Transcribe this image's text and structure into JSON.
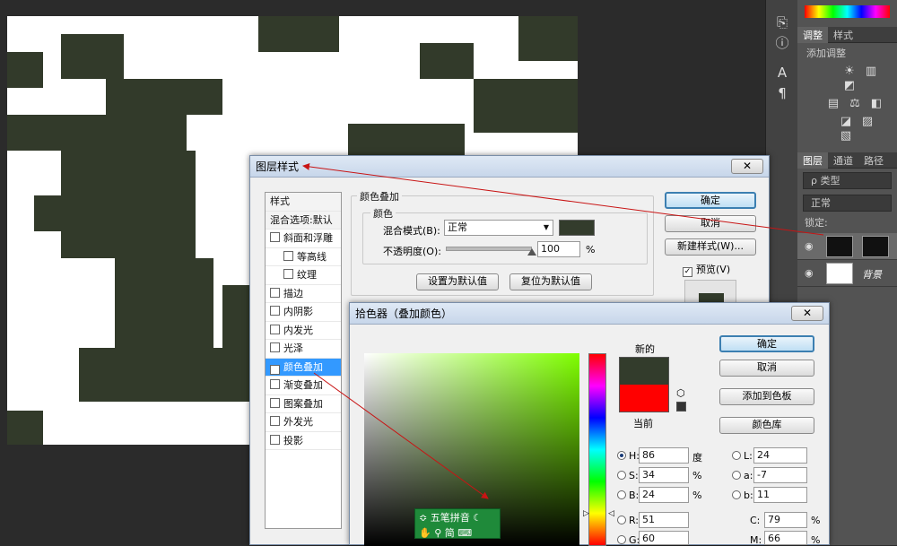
{
  "layer_style": {
    "title": "图层样式",
    "close": "✕",
    "styles_header": "样式",
    "blend_options": "混合选项:默认",
    "items": [
      {
        "label": "斜面和浮雕",
        "checked": false,
        "sub": false
      },
      {
        "label": "等高线",
        "checked": false,
        "sub": true
      },
      {
        "label": "纹理",
        "checked": false,
        "sub": true
      },
      {
        "label": "描边",
        "checked": false,
        "sub": false
      },
      {
        "label": "内阴影",
        "checked": false,
        "sub": false
      },
      {
        "label": "内发光",
        "checked": false,
        "sub": false
      },
      {
        "label": "光泽",
        "checked": false,
        "sub": false
      },
      {
        "label": "颜色叠加",
        "checked": true,
        "sub": false,
        "selected": true
      },
      {
        "label": "渐变叠加",
        "checked": false,
        "sub": false
      },
      {
        "label": "图案叠加",
        "checked": false,
        "sub": false
      },
      {
        "label": "外发光",
        "checked": false,
        "sub": false
      },
      {
        "label": "投影",
        "checked": false,
        "sub": false
      }
    ],
    "section_title": "颜色叠加",
    "color_group": "颜色",
    "blend_mode_label": "混合模式(B):",
    "blend_mode_value": "正常",
    "opacity_label": "不透明度(O):",
    "opacity_value": "100",
    "opacity_unit": "%",
    "opacity_fraction": 1.0,
    "swatch_color": "#333c2c",
    "set_default": "设置为默认值",
    "reset_default": "复位为默认值",
    "ok": "确定",
    "cancel": "取消",
    "new_style": "新建样式(W)...",
    "preview_label": "预览(V)",
    "preview_checked": true
  },
  "color_picker": {
    "title": "拾色器（叠加颜色）",
    "close": "✕",
    "new_label": "新的",
    "current_label": "当前",
    "new_color": "#333c2c",
    "current_color": "#ff0000",
    "ok": "确定",
    "cancel": "取消",
    "add_swatch": "添加到色板",
    "color_lib": "颜色库",
    "h_label": "H:",
    "h_value": "86",
    "h_unit": "度",
    "s_label": "S:",
    "s_value": "34",
    "s_unit": "%",
    "b_label": "B:",
    "b_value": "24",
    "b_unit": "%",
    "r_label": "R:",
    "r_value": "51",
    "g_label": "G:",
    "g_value": "60",
    "l_label": "L:",
    "l_value": "24",
    "a_label": "a:",
    "a_value": "-7",
    "bb_label": "b:",
    "bb_value": "11",
    "c_label": "C:",
    "c_value": "79",
    "c_unit": "%",
    "m_label": "M:",
    "m_value": "66",
    "m_unit": "%",
    "ime_name": "五笔拼音",
    "ime_jian": "简"
  },
  "right_panel": {
    "tab_adjust": "调整",
    "tab_styles": "样式",
    "add_adjust": "添加调整",
    "tab_layers": "图层",
    "tab_channels": "通道",
    "tab_paths": "路径",
    "filter_kind": "ρ 类型",
    "blend_mode": "正常",
    "lock_label": "锁定:",
    "bg_layer": "背景"
  }
}
